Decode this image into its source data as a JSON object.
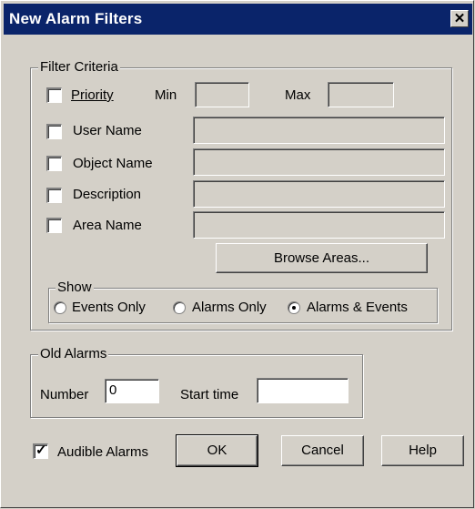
{
  "window": {
    "title": "New Alarm Filters",
    "close_glyph": "✕"
  },
  "filter_criteria": {
    "group_label": "Filter Criteria",
    "priority": {
      "label": "Priority",
      "checked": false
    },
    "min_label": "Min",
    "min_value": "",
    "max_label": "Max",
    "max_value": "",
    "user_name": {
      "label": "User Name",
      "checked": false,
      "value": ""
    },
    "object_name": {
      "label": "Object Name",
      "checked": false,
      "value": ""
    },
    "description": {
      "label": "Description",
      "checked": false,
      "value": ""
    },
    "area_name": {
      "label": "Area Name",
      "checked": false,
      "value": ""
    },
    "browse_button": "Browse Areas...",
    "show": {
      "group_label": "Show",
      "options": [
        {
          "label": "Events Only",
          "selected": false
        },
        {
          "label": "Alarms Only",
          "selected": false
        },
        {
          "label": "Alarms & Events",
          "selected": true
        }
      ]
    }
  },
  "old_alarms": {
    "group_label": "Old Alarms",
    "number_label": "Number",
    "number_value": "0",
    "start_time_label": "Start time",
    "start_time_value": ""
  },
  "audible_alarms": {
    "label": "Audible Alarms",
    "checked": true,
    "checkmark": "✓"
  },
  "buttons": {
    "ok": "OK",
    "cancel": "Cancel",
    "help": "Help"
  }
}
